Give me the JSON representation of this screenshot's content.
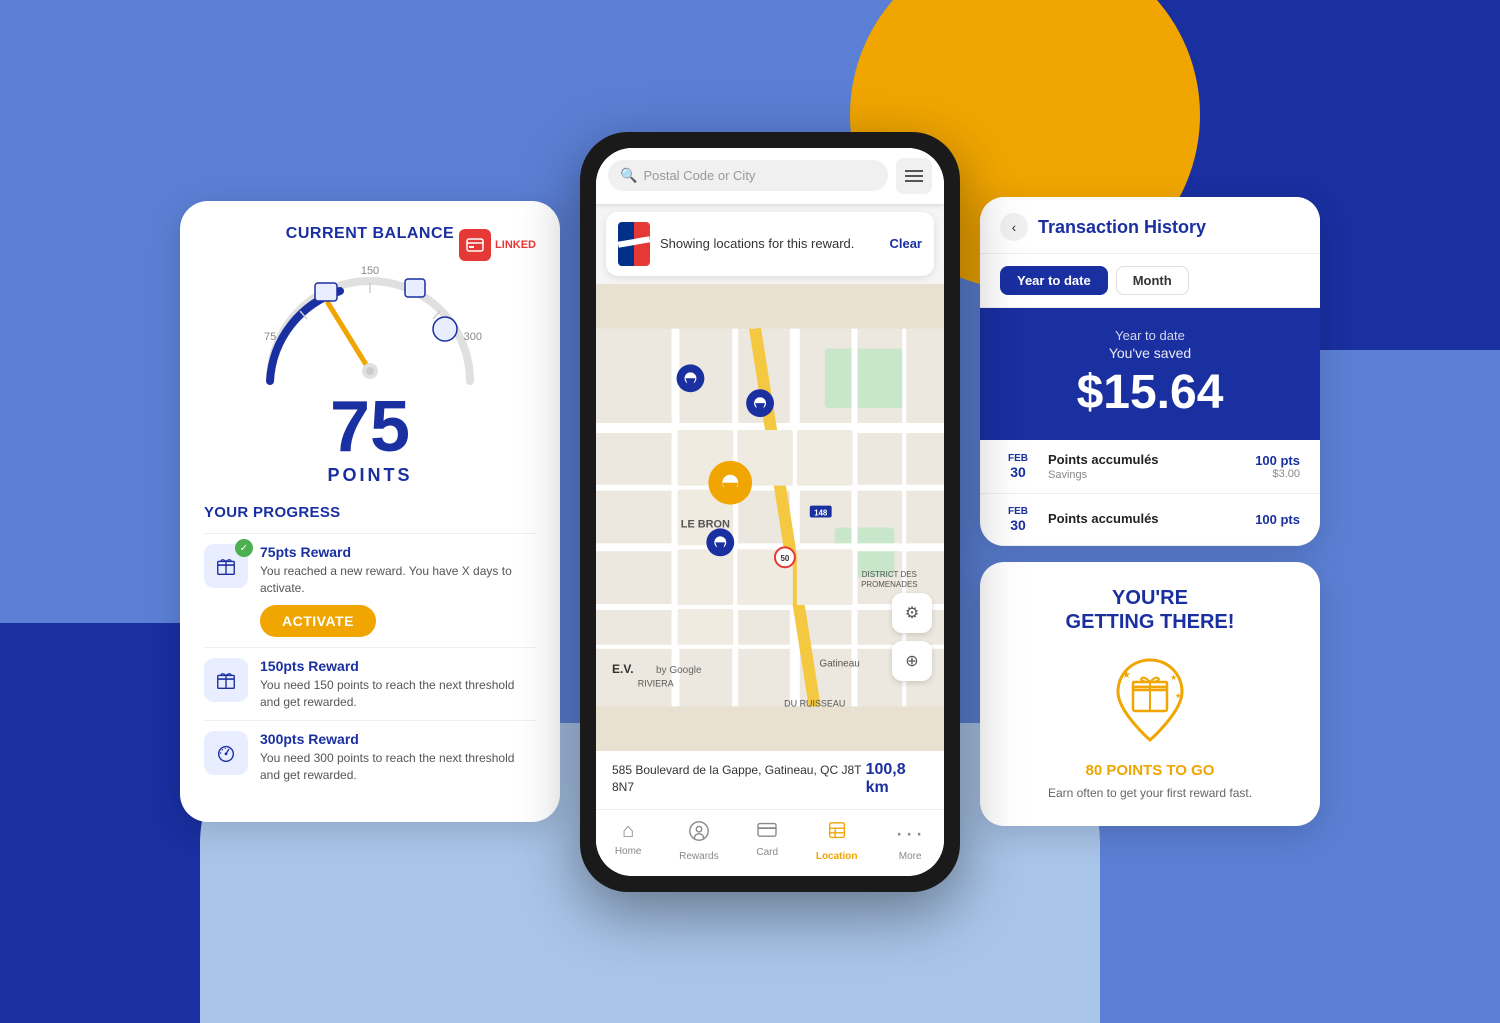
{
  "background": {
    "colors": {
      "main": "#5b7fd4",
      "dark_blue": "#1a2fa0",
      "orange": "#f0a500",
      "light_blue": "#a8c4e8"
    }
  },
  "left_panel": {
    "title": "CURRENT BALANCE",
    "linked_label": "LINKED",
    "points_number": "75",
    "points_label": "POINTS",
    "gauge_labels": {
      "low": "75",
      "mid": "150",
      "high": "300"
    },
    "your_progress": "YOUR PROGRESS",
    "rewards": [
      {
        "title": "75pts Reward",
        "desc": "You reached a new reward. You have X days to activate.",
        "activated": true,
        "activate_label": "ACTIVATE"
      },
      {
        "title": "150pts Reward",
        "desc": "You need 150 points to reach the next threshold and get rewarded.",
        "activated": false
      },
      {
        "title": "300pts Reward",
        "desc": "You need 300 points to reach the next threshold and get rewarded.",
        "activated": false
      }
    ]
  },
  "middle_phone": {
    "search_placeholder": "Postal Code or City",
    "reward_banner_text": "Showing locations for this reward.",
    "clear_label": "Clear",
    "address": "585 Boulevard de la Gappe, Gatineau, QC J8T 8N7",
    "distance": "100,8 km",
    "ev_label": "E.V.",
    "google_label": "by Google",
    "nav_items": [
      {
        "icon": "🏠",
        "label": "Home",
        "active": false
      },
      {
        "icon": "🎁",
        "label": "Rewards",
        "active": false
      },
      {
        "icon": "💳",
        "label": "Card",
        "active": false
      },
      {
        "icon": "📖",
        "label": "Location",
        "active": true
      },
      {
        "icon": "•••",
        "label": "More",
        "active": false
      }
    ]
  },
  "right_panel": {
    "transaction_history": {
      "back_icon": "‹",
      "title": "Transaction History",
      "tabs": [
        {
          "label": "Year to date",
          "active": true
        },
        {
          "label": "Month",
          "active": false
        }
      ],
      "savings_period": "Year to date",
      "savings_headline": "You've saved",
      "savings_amount": "$15.64",
      "transactions": [
        {
          "month": "FEB",
          "day": "30",
          "name": "Points accumulés",
          "sub": "Savings",
          "pts": "100 pts",
          "savings": "$3.00"
        },
        {
          "month": "FEB",
          "day": "30",
          "name": "Points accumulés",
          "sub": "",
          "pts": "100 pts",
          "savings": ""
        }
      ]
    },
    "getting_there": {
      "title": "YOU'RE\nGETTING THERE!",
      "points_to_go": "80 POINTS TO GO",
      "desc": "Earn often to get your first reward fast."
    }
  }
}
